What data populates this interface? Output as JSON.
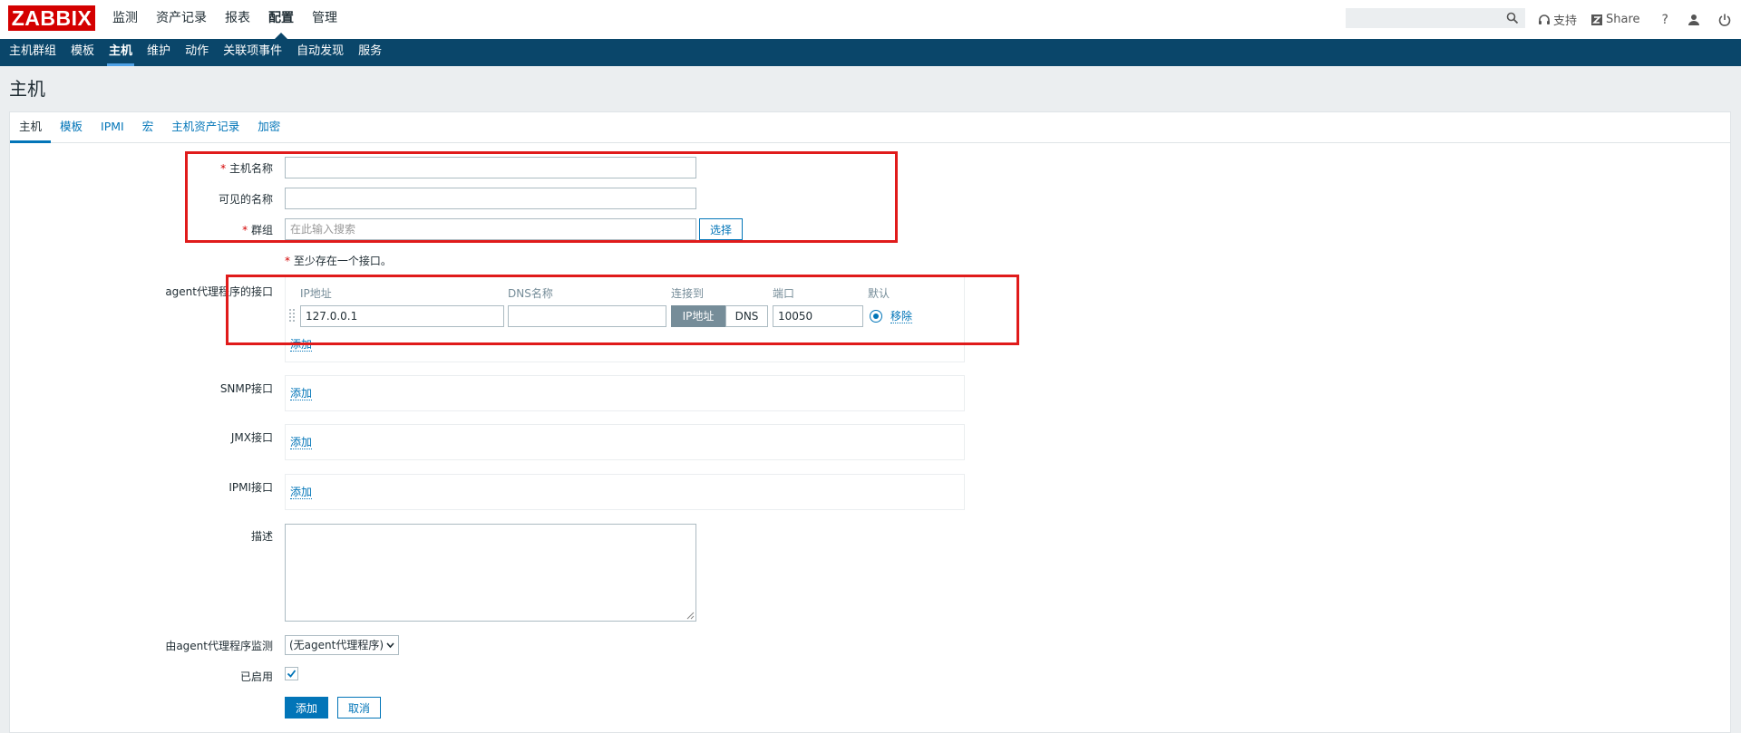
{
  "logo": {
    "text": "ZABBIX"
  },
  "topnav": [
    "监测",
    "资产记录",
    "报表",
    "配置",
    "管理"
  ],
  "search": {
    "placeholder": ""
  },
  "topright": {
    "support": "支持",
    "share": "Share",
    "help": "?"
  },
  "subnav": [
    "主机群组",
    "模板",
    "主机",
    "维护",
    "动作",
    "关联项事件",
    "自动发现",
    "服务"
  ],
  "page_title": "主机",
  "tabs": [
    "主机",
    "模板",
    "IPMI",
    "宏",
    "主机资产记录",
    "加密"
  ],
  "form": {
    "host_name_label": "主机名称",
    "host_name_value": "",
    "visible_name_label": "可见的名称",
    "visible_name_value": "",
    "groups_label": "群组",
    "groups_placeholder": "在此输入搜索",
    "select_button": "选择",
    "req_marker": "*",
    "interface_note": "至少存在一个接口。",
    "agent_label": "agent代理程序的接口",
    "col_ip": "IP地址",
    "col_dns": "DNS名称",
    "col_connect": "连接到",
    "col_port": "端口",
    "col_default": "默认",
    "ip_value": "127.0.0.1",
    "dns_value": "",
    "connect_ip": "IP地址",
    "connect_dns": "DNS",
    "port_value": "10050",
    "remove_link": "移除",
    "add_link": "添加",
    "snmp_label": "SNMP接口",
    "jmx_label": "JMX接口",
    "ipmi_label": "IPMI接口",
    "description_label": "描述",
    "proxy_label": "由agent代理程序监测",
    "proxy_value": "(无agent代理程序)",
    "enabled_label": "已启用",
    "add_button": "添加",
    "cancel_button": "取消"
  },
  "colors": {
    "brand": "#d40000",
    "nav": "#0a466a",
    "link": "#0275b8",
    "annotation": "#e01b1b"
  }
}
